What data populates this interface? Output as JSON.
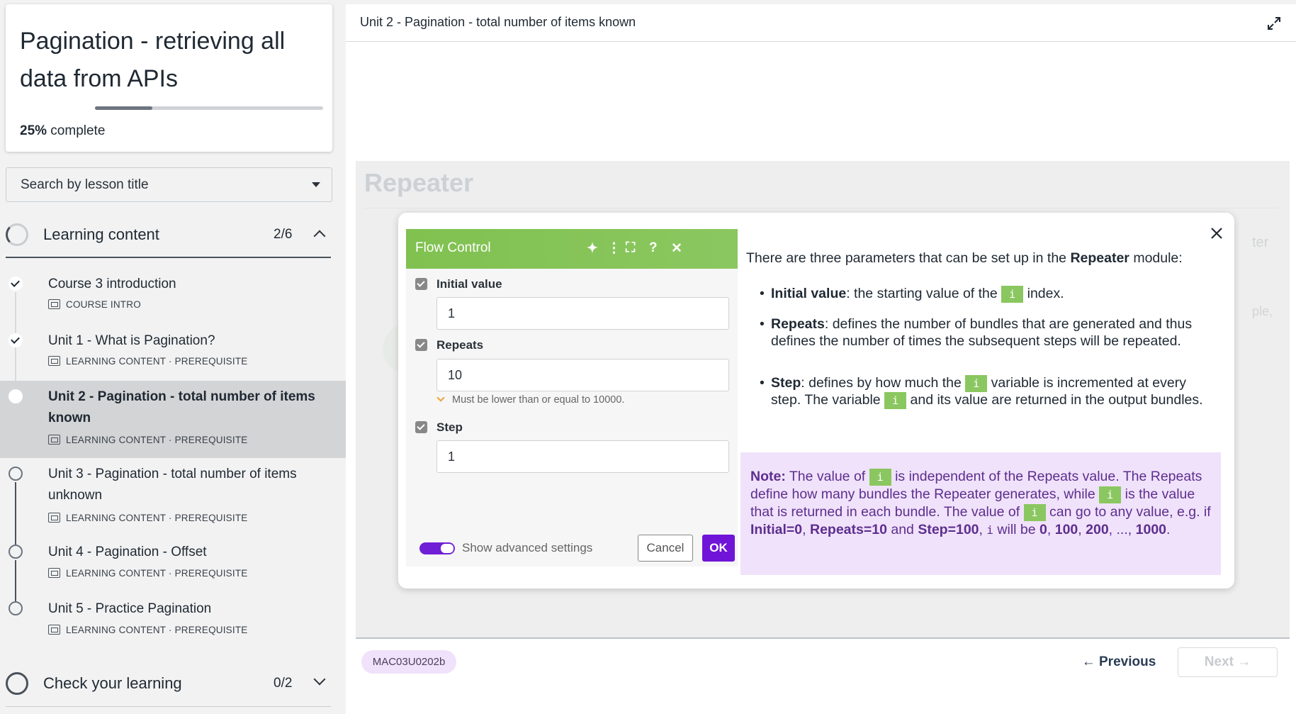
{
  "course": {
    "title": "Pagination - retrieving all data from APIs",
    "progress_percent": "25%",
    "progress_suffix": " complete",
    "progress_value": 0.25
  },
  "search": {
    "placeholder": "Search by lesson title"
  },
  "sections": [
    {
      "label": "Learning content",
      "count": "2/6",
      "expanded": true
    },
    {
      "label": "Check your learning",
      "count": "0/2",
      "expanded": false
    }
  ],
  "lessons": [
    {
      "title": "Course 3 introduction",
      "meta": "COURSE INTRO",
      "status": "done"
    },
    {
      "title": "Unit 1 - What is Pagination?",
      "meta": "LEARNING CONTENT · PREREQUISITE",
      "status": "done"
    },
    {
      "title": "Unit 2 - Pagination - total number of items known",
      "meta": "LEARNING CONTENT · PREREQUISITE",
      "status": "current"
    },
    {
      "title": "Unit 3 - Pagination - total number of items unknown",
      "meta": "LEARNING CONTENT · PREREQUISITE",
      "status": "todo"
    },
    {
      "title": "Unit 4 - Pagination - Offset",
      "meta": "LEARNING CONTENT · PREREQUISITE",
      "status": "todo"
    },
    {
      "title": "Unit 5 - Practice Pagination",
      "meta": "LEARNING CONTENT · PREREQUISITE",
      "status": "todo"
    }
  ],
  "header": {
    "title": "Unit 2 - Pagination - total number of items known"
  },
  "stage": {
    "heading": "Repeater",
    "ghost_text_1": "ter",
    "ghost_text_2": "ple,"
  },
  "flow_control": {
    "title": "Flow Control",
    "fields": [
      {
        "label": "Initial value",
        "value": "1"
      },
      {
        "label": "Repeats",
        "value": "10",
        "hint": "Must be lower than or equal to 10000."
      },
      {
        "label": "Step",
        "value": "1"
      }
    ],
    "advanced_label": "Show advanced settings",
    "cancel_label": "Cancel",
    "ok_label": "OK"
  },
  "explanation": {
    "intro_pre": "There are three parameters that can be set up in the ",
    "intro_bold": "Repeater",
    "intro_post": " module:",
    "code_var": "i",
    "b1_bold": "Initial value",
    "b1_pre": ": the starting value of the ",
    "b1_post": " index.",
    "b2_bold": "Repeats",
    "b2_text": ": defines the number of bundles that are generated and thus defines the number of times the subsequent steps will be repeated.",
    "b3_bold": "Step",
    "b3_pre": ": defines by how much the ",
    "b3_mid": " variable is incremented at every step. The variable ",
    "b3_post": " and its value are returned in the output bundles."
  },
  "note": {
    "label": "Note:",
    "t1": " The value of ",
    "t2": " is independent of the Repeats value. The Repeats define how many bundles the Repeater generates, while ",
    "t3": " is the value that is returned in each bundle. The value of ",
    "t4": " can go to any value, e.g. if ",
    "initial": "Initial=0",
    "repeats": "Repeats=10",
    "and": " and ",
    "step": "Step=100",
    "t5": ", ",
    "t6": " will be ",
    "v0": "0",
    "v100": "100",
    "v200": "200",
    "ellipsis": "...",
    "v1000": "1000",
    "comma": ", ",
    "period": "."
  },
  "footer": {
    "tag": "MAC03U0202b",
    "prev_label": "← Previous",
    "next_label": "Next →"
  }
}
